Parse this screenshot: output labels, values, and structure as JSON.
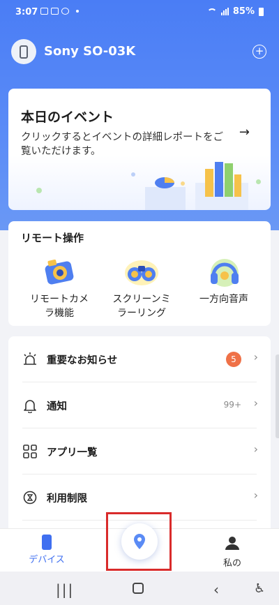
{
  "status_bar": {
    "time": "3:07",
    "battery": "85%"
  },
  "header": {
    "device_name": "Sony SO-03K"
  },
  "event_card": {
    "title": "本日のイベント",
    "description": "クリックするとイベントの詳細レポートをご覧いただけます。"
  },
  "remote": {
    "title": "リモート操作",
    "items": [
      {
        "label": "リモートカメ\nラ機能",
        "icon": "camera-icon"
      },
      {
        "label": "スクリーンミ\nラーリング",
        "icon": "binoculars-icon"
      },
      {
        "label": "一方向音声",
        "icon": "headphones-icon"
      }
    ]
  },
  "list": {
    "items": [
      {
        "label": "重要なお知らせ",
        "badge": "5",
        "icon": "alarm-icon"
      },
      {
        "label": "通知",
        "count": "99+",
        "icon": "bell-icon"
      },
      {
        "label": "アプリ一覧",
        "icon": "grid-icon"
      },
      {
        "label": "利用制限",
        "icon": "hourglass-clock-icon"
      }
    ]
  },
  "bottom_nav": {
    "device": "デバイス",
    "me": "私の"
  },
  "colors": {
    "accent": "#3f6ff0",
    "header_bg": "#4a7df5",
    "badge": "#ef7147",
    "highlight": "#d92b2b"
  }
}
